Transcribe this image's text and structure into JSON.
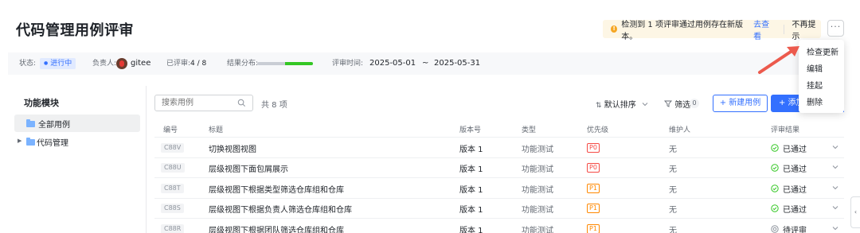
{
  "header": {
    "title": "代码管理用例评审",
    "notice": {
      "text": "检测到 1 项评审通过用例存在新版本。",
      "link": "去查看",
      "dismiss": "不再提示"
    },
    "more_label": "···"
  },
  "meta": {
    "status_label": "状态:",
    "status_value": "进行中",
    "owner_label": "负责人:",
    "owner_name": "gitee",
    "reviewed_label": "已评审:",
    "reviewed_value": "4 / 8",
    "distribution_label": "结果分布:",
    "distribution_passed_fraction": 0.5,
    "time_label": "评审时间:",
    "time_start": "2025-05-01",
    "time_sep": "~",
    "time_end": "2025-05-31"
  },
  "menu": {
    "items": [
      "检查更新",
      "编辑",
      "挂起",
      "删除"
    ]
  },
  "left_panel": {
    "title": "功能模块",
    "tree": [
      {
        "label": "全部用例",
        "selected": true
      },
      {
        "label": "代码管理",
        "selected": false
      }
    ]
  },
  "toolbar": {
    "search_placeholder": "搜索用例",
    "total": "共 8 项",
    "sort_label": "默认排序",
    "filter_label": "筛选",
    "filter_count": "0",
    "new_label": "+ 新建用例",
    "add_label": "+ 添加"
  },
  "table": {
    "columns": [
      "编号",
      "标题",
      "版本号",
      "类型",
      "优先级",
      "维护人",
      "评审结果"
    ],
    "rows": [
      {
        "id": "C88V",
        "title": "切换视图视图",
        "version": "版本 1",
        "type": "功能测试",
        "priority": "P0",
        "maintainer": "无",
        "result": "已通过"
      },
      {
        "id": "C88U",
        "title": "层级视图下面包屑展示",
        "version": "版本 1",
        "type": "功能测试",
        "priority": "P0",
        "maintainer": "无",
        "result": "已通过"
      },
      {
        "id": "C88T",
        "title": "层级视图下根据类型筛选仓库组和仓库",
        "version": "版本 1",
        "type": "功能测试",
        "priority": "P1",
        "maintainer": "无",
        "result": "已通过"
      },
      {
        "id": "C88S",
        "title": "层级视图下根据负责人筛选仓库组和仓库",
        "version": "版本 1",
        "type": "功能测试",
        "priority": "P1",
        "maintainer": "无",
        "result": "已通过"
      },
      {
        "id": "C88R",
        "title": "层级视图下根据团队筛选仓库组和仓库",
        "version": "版本 1",
        "type": "功能测试",
        "priority": "P1",
        "maintainer": "无",
        "result": "待评审"
      }
    ]
  },
  "colors": {
    "accent": "#3370ff",
    "p0": "#f54a45",
    "p1": "#ff8800",
    "passed": "#34c724",
    "pending": "#8f959e",
    "arrow": "#ec5a4d"
  },
  "side_tab_glyph": "‹"
}
